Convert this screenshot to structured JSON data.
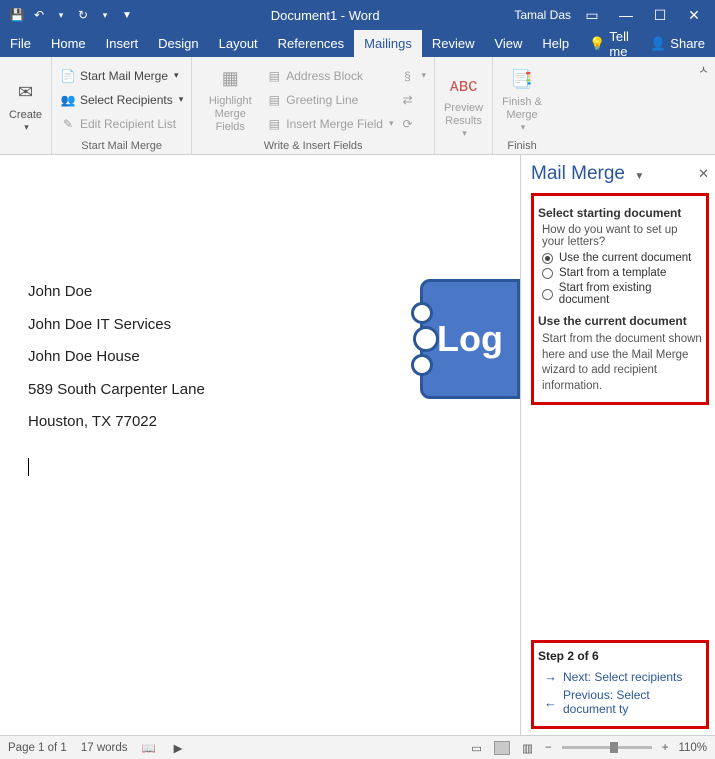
{
  "titlebar": {
    "doc_title": "Document1 - Word",
    "username": "Tamal Das"
  },
  "menutabs": {
    "file": "File",
    "home": "Home",
    "insert": "Insert",
    "design": "Design",
    "layout": "Layout",
    "references": "References",
    "mailings": "Mailings",
    "review": "Review",
    "view": "View",
    "help": "Help",
    "tellme": "Tell me",
    "share": "Share"
  },
  "ribbon": {
    "create_group": {
      "create": "Create",
      "label": ""
    },
    "startmm_group": {
      "start_mail_merge": "Start Mail Merge",
      "select_recipients": "Select Recipients",
      "edit_recipient_list": "Edit Recipient List",
      "label": "Start Mail Merge"
    },
    "write_group": {
      "highlight": "Highlight Merge Fields",
      "address_block": "Address Block",
      "greeting_line": "Greeting Line",
      "insert_merge_field": "Insert Merge Field",
      "label": "Write & Insert Fields"
    },
    "preview_group": {
      "preview": "Preview Results",
      "label": ""
    },
    "finish_group": {
      "finish": "Finish & Merge",
      "label": "Finish"
    }
  },
  "document": {
    "line1": "John Doe",
    "line2": "John Doe IT Services",
    "line3": "John Doe House",
    "line4": "589 South Carpenter Lane",
    "line5": "Houston, TX 77022",
    "logo_text": "Log"
  },
  "taskpane": {
    "title": "Mail Merge",
    "section1_title": "Select starting document",
    "question": "How do you want to set up your letters?",
    "opt1": "Use the current document",
    "opt2": "Start from a template",
    "opt3": "Start from existing document",
    "section2_title": "Use the current document",
    "desc": "Start from the document shown here and use the Mail Merge wizard to add recipient information.",
    "step_title": "Step 2 of 6",
    "next": "Next: Select recipients",
    "prev": "Previous: Select document ty"
  },
  "statusbar": {
    "page": "Page 1 of 1",
    "words": "17 words",
    "zoom": "110%"
  }
}
